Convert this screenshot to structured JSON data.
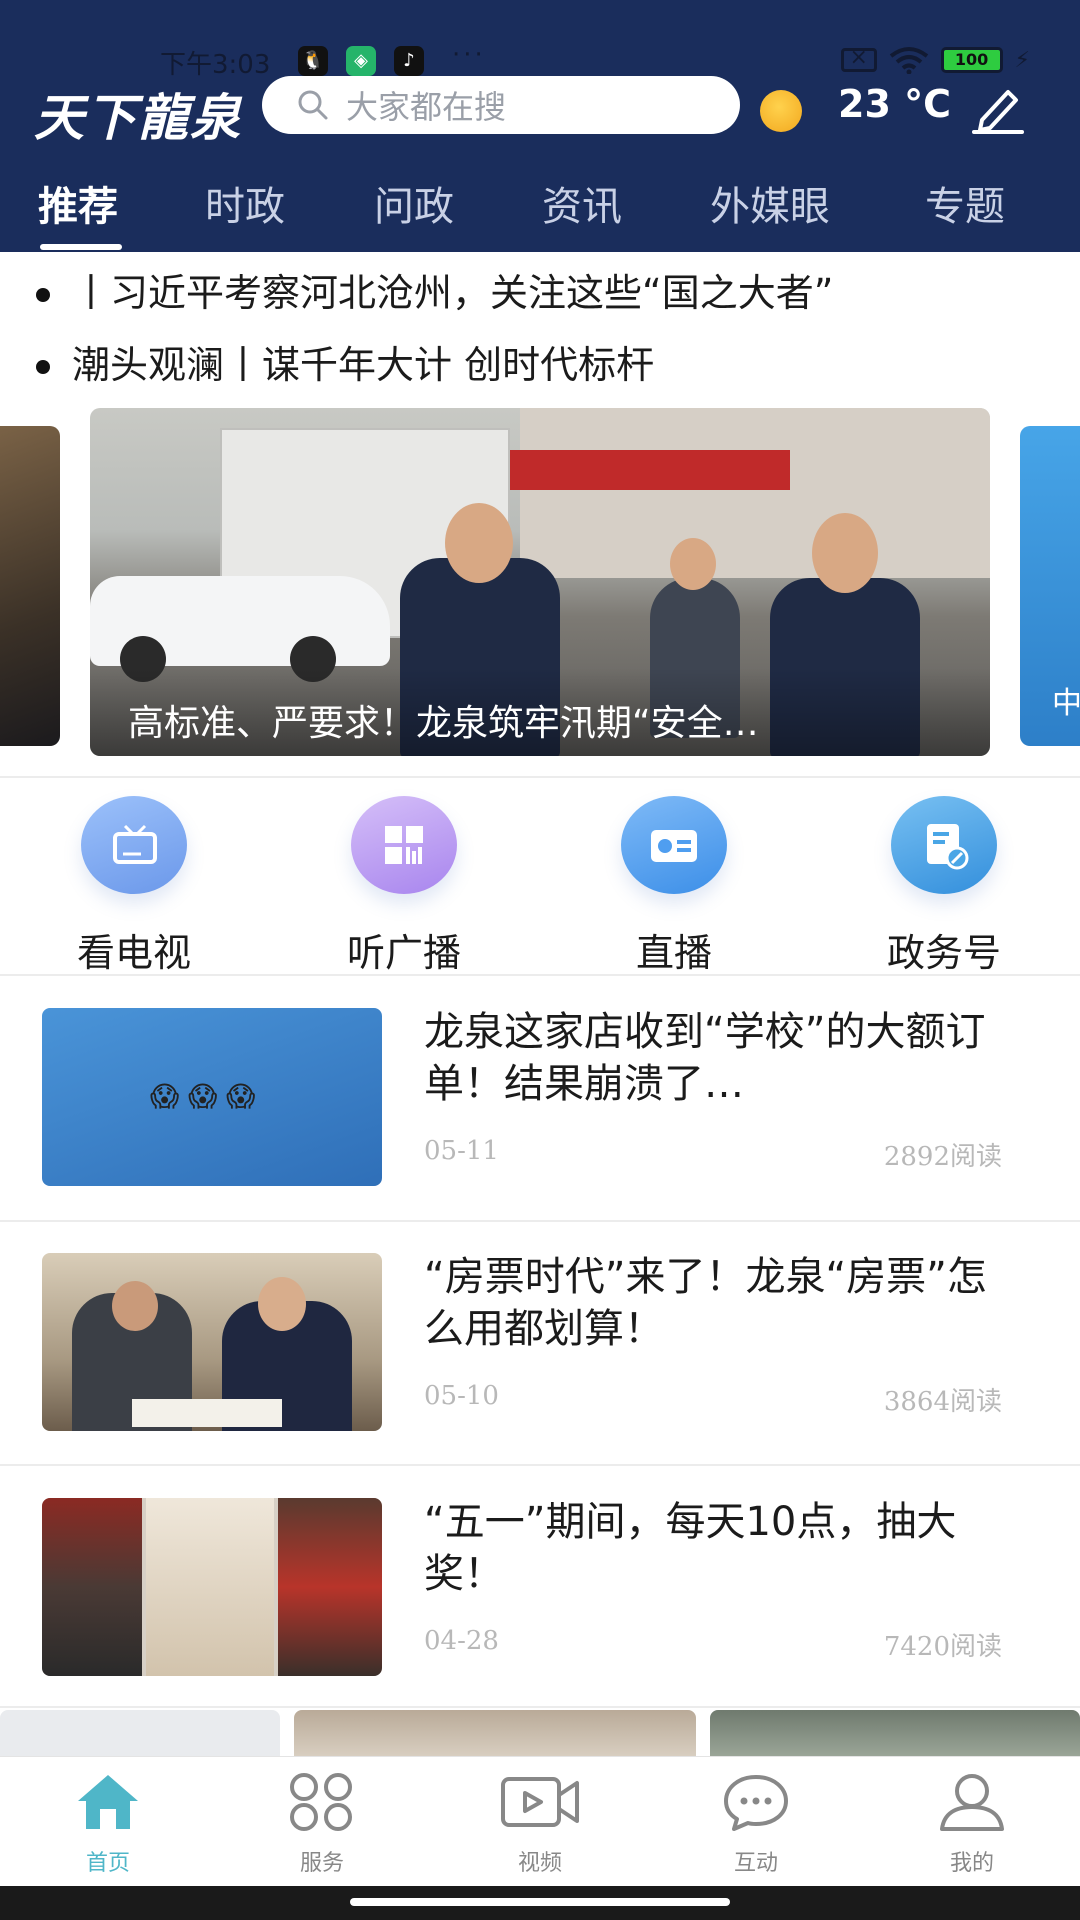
{
  "status_bar": {
    "time": "下午3:03",
    "battery": "100",
    "app_icons": [
      "qq-icon",
      "shield-app-icon",
      "tiktok-icon"
    ],
    "more": "···"
  },
  "header": {
    "logo_text": "天下龍泉",
    "search_placeholder": "大家都在搜",
    "weather": {
      "icon": "sun-icon",
      "temperature": "23 °C"
    },
    "edit_icon": "edit-icon"
  },
  "tabs": [
    {
      "label": "推荐",
      "active": true
    },
    {
      "label": "时政",
      "active": false
    },
    {
      "label": "问政",
      "active": false
    },
    {
      "label": "资讯",
      "active": false
    },
    {
      "label": "外媒眼",
      "active": false
    },
    {
      "label": "专题",
      "active": false
    }
  ],
  "headlines": [
    "丨习近平考察河北沧州，关注这些“国之大者”",
    "潮头观澜丨谋千年大计 创时代标杆"
  ],
  "carousel": {
    "main_caption": "高标准、严要求！龙泉筑牢汛期“安全…",
    "left_caption": "…",
    "right_caption": "中"
  },
  "quick_links": [
    {
      "label": "看电视",
      "icon": "tv-icon",
      "color": "#7aa7f0"
    },
    {
      "label": "听广播",
      "icon": "grid-icon",
      "color": "#b99af0"
    },
    {
      "label": "直播",
      "icon": "radio-icon",
      "color": "#4f9ef0"
    },
    {
      "label": "政务号",
      "icon": "document-icon",
      "color": "#4aa6e6"
    }
  ],
  "news": [
    {
      "title": "龙泉这家店收到“学校”的大额订单！结果崩溃了…",
      "date": "05-11",
      "reads": "2892阅读",
      "thumb_emoji": "😱 😱 😱"
    },
    {
      "title": "“房票时代”来了！龙泉“房票”怎么用都划算！",
      "date": "05-10",
      "reads": "3864阅读"
    },
    {
      "title": "“五一”期间，每天10点，抽大奖！",
      "date": "04-28",
      "reads": "7420阅读"
    }
  ],
  "bottom_nav": [
    {
      "label": "首页",
      "icon": "home-icon",
      "active": true
    },
    {
      "label": "服务",
      "icon": "services-icon",
      "active": false
    },
    {
      "label": "视频",
      "icon": "video-icon",
      "active": false
    },
    {
      "label": "互动",
      "icon": "chat-icon",
      "active": false
    },
    {
      "label": "我的",
      "icon": "profile-icon",
      "active": false
    }
  ],
  "colors": {
    "header_bg": "#1a2d5c",
    "accent": "#4fb6c8",
    "muted_text": "#b8b8b8"
  }
}
